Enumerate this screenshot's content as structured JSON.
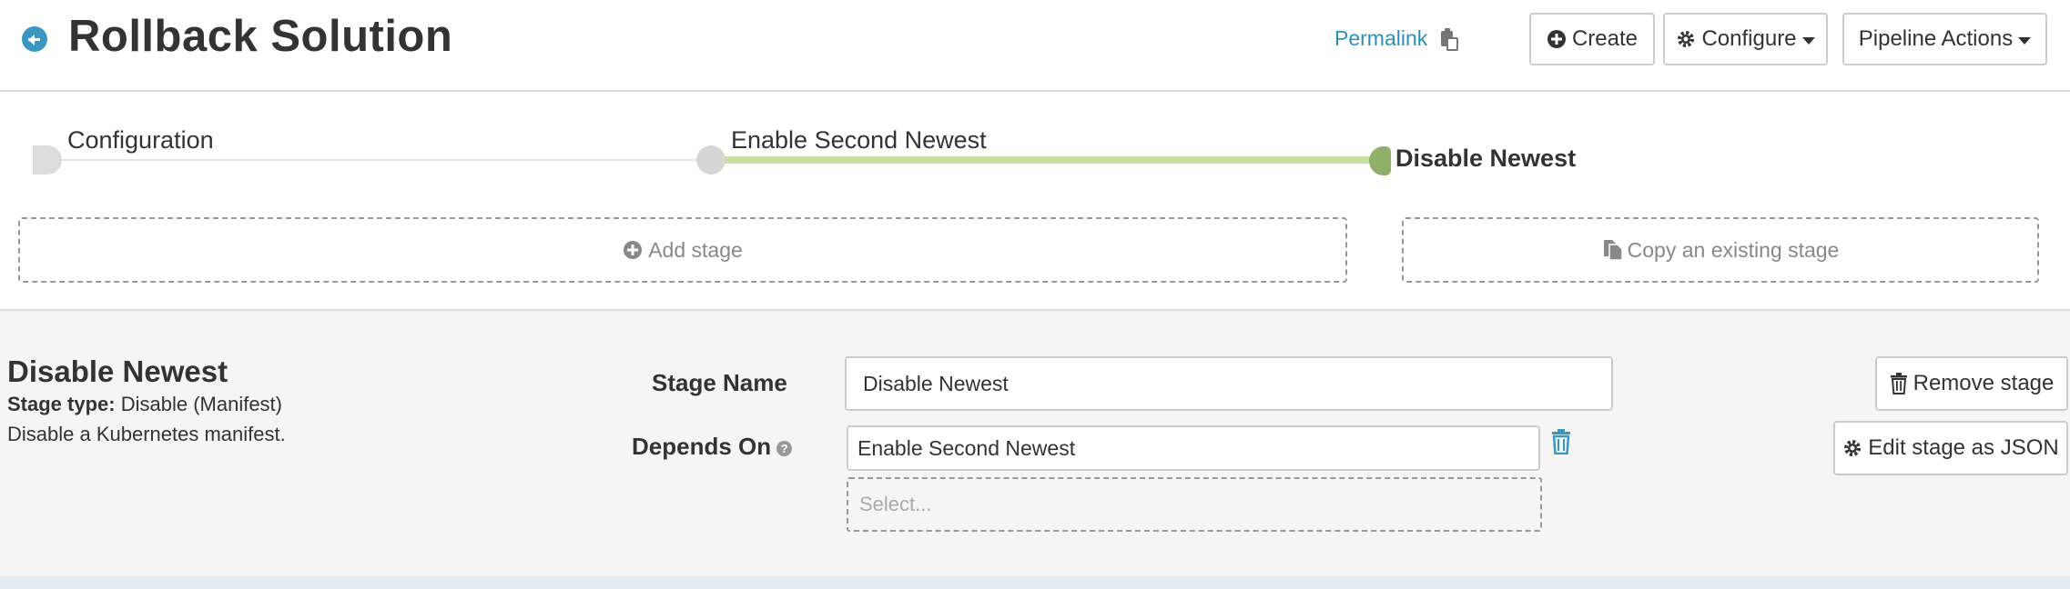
{
  "header": {
    "title": "Rollback Solution",
    "permalink": "Permalink",
    "create_label": "Create",
    "configure_label": "Configure",
    "pipeline_actions_label": "Pipeline Actions"
  },
  "graph": {
    "stages": [
      {
        "label": "Configuration",
        "active": false
      },
      {
        "label": "Enable Second Newest",
        "active": false
      },
      {
        "label": "Disable Newest",
        "active": true
      }
    ],
    "add_stage_label": "Add stage",
    "copy_stage_label": "Copy an existing stage"
  },
  "stage": {
    "heading": "Disable Newest",
    "type_label": "Stage type:",
    "type_value": "Disable (Manifest)",
    "description": "Disable a Kubernetes manifest.",
    "name_label": "Stage Name",
    "name_value": "Disable Newest",
    "depends_label": "Depends On",
    "depends_value": "Enable Second Newest",
    "select_placeholder": "Select...",
    "remove_label": "Remove stage",
    "edit_json_label": "Edit stage as JSON"
  },
  "colors": {
    "accent": "#3a97bf",
    "link": "#2c8fb9",
    "active_track": "#c6dfa1",
    "active_node": "#8eb068"
  }
}
